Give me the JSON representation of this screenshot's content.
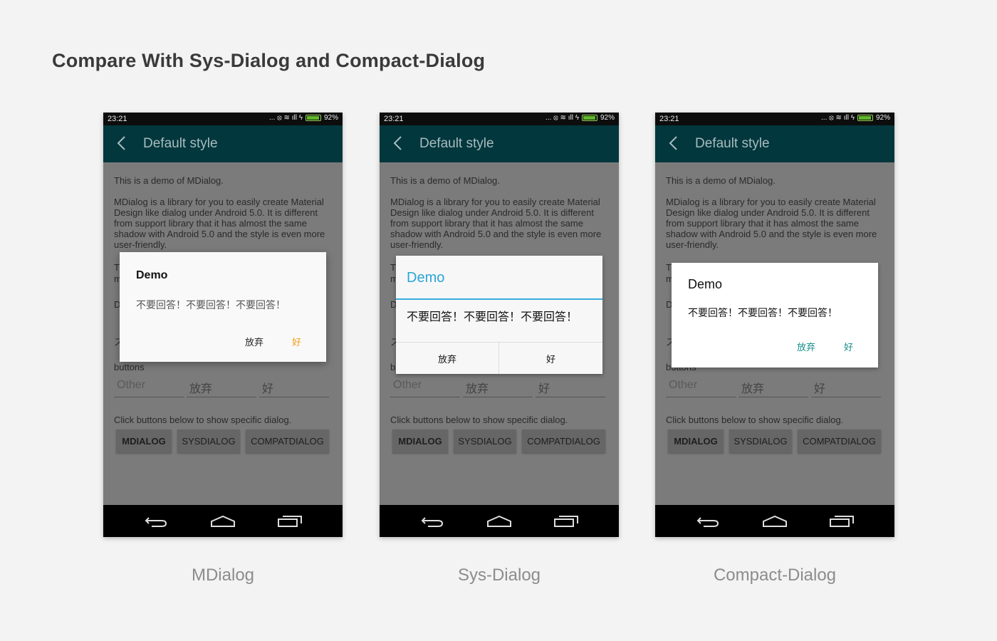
{
  "page": {
    "title": "Compare With Sys-Dialog and Compact-Dialog"
  },
  "phone_common": {
    "status_time": "23:21",
    "status_icons": "... ⦻ ≋ ıll ϟ",
    "battery": "92%",
    "toolbar_title": "Default style",
    "intro": "This is a demo of MDialog.",
    "description": "MDialog is a library for you to easily create Material Design like dialog under Android 5.0. It is different from support library that it has almost the same shadow with Android 5.0 and the style is even more user-friendly.",
    "fragment_t": "T",
    "fragment_m": "m",
    "fragment_d": "D",
    "fragment_z": "ス",
    "fragment_buttons": "buttons",
    "fragment_b": "b",
    "fragment_bu": "buttons",
    "field_other": "Other",
    "field_negative": "放弃",
    "field_positive": "好",
    "hint": "Click buttons below to show specific dialog.",
    "buttons": [
      "MDIALOG",
      "SYSDIALOG",
      "COMPATDIALOG"
    ]
  },
  "dialogs": {
    "mdialog": {
      "title": "Demo",
      "message": "不要回答！不要回答！不要回答！",
      "negative": "放弃",
      "positive": "好"
    },
    "sysdialog": {
      "title": "Demo",
      "message": "不要回答！不要回答！不要回答！",
      "negative": "放弃",
      "positive": "好"
    },
    "compatdialog": {
      "title": "Demo",
      "message": "不要回答！不要回答！不要回答！",
      "negative": "放弃",
      "positive": "好"
    }
  },
  "captions": [
    "MDialog",
    "Sys-Dialog",
    "Compact-Dialog"
  ],
  "colors": {
    "toolbar": "#02373d",
    "mdialog_positive": "#f39c12",
    "sys_accent": "#2aa6d6",
    "compat_accent": "#158c8a"
  }
}
